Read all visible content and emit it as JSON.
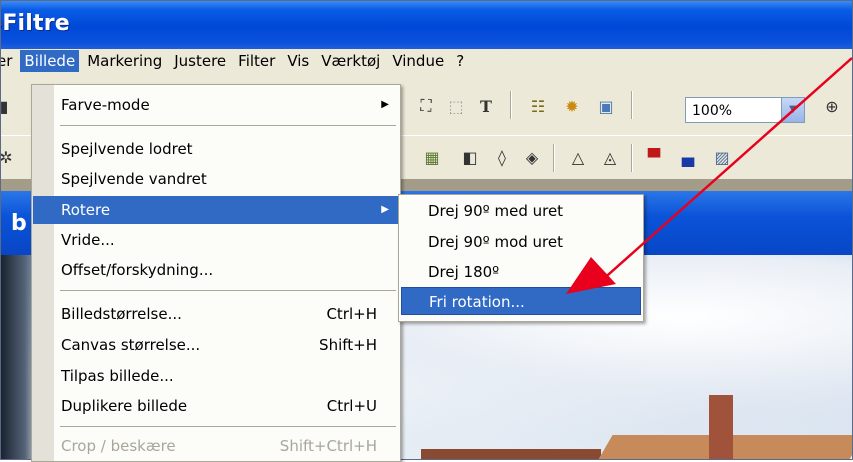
{
  "window": {
    "title": "oFiltre"
  },
  "menubar": {
    "items": [
      "er",
      "Billede",
      "Markering",
      "Justere",
      "Filter",
      "Vis",
      "Værktøj",
      "Vindue",
      "?"
    ],
    "active": "Billede"
  },
  "toolbar": {
    "zoom": "100%"
  },
  "document": {
    "title_fragment": "b"
  },
  "dropdown": {
    "items": {
      "farve_mode": "Farve-mode",
      "spejl_lodret": "Spejlvende lodret",
      "spejl_vandret": "Spejlvende vandret",
      "rotere": "Rotere",
      "vride": "Vride...",
      "offset": "Offset/forskydning...",
      "billedstorrelse": "Billedstørrelse...",
      "billedstorrelse_sc": "Ctrl+H",
      "canvas": "Canvas størrelse...",
      "canvas_sc": "Shift+H",
      "tilpas": "Tilpas billede...",
      "duplikere": "Duplikere billede",
      "duplikere_sc": "Ctrl+U",
      "crop": "Crop / beskære",
      "crop_sc": "Shift+Ctrl+H"
    }
  },
  "submenu": {
    "items": [
      "Drej 90º med uret",
      "Drej 90º mod uret",
      "Drej 180º",
      "Fri rotation..."
    ],
    "highlighted": "Fri rotation..."
  },
  "colors": {
    "accent": "#316ac5",
    "titlebar": "#0048d8",
    "annotation": "#e8001c"
  }
}
